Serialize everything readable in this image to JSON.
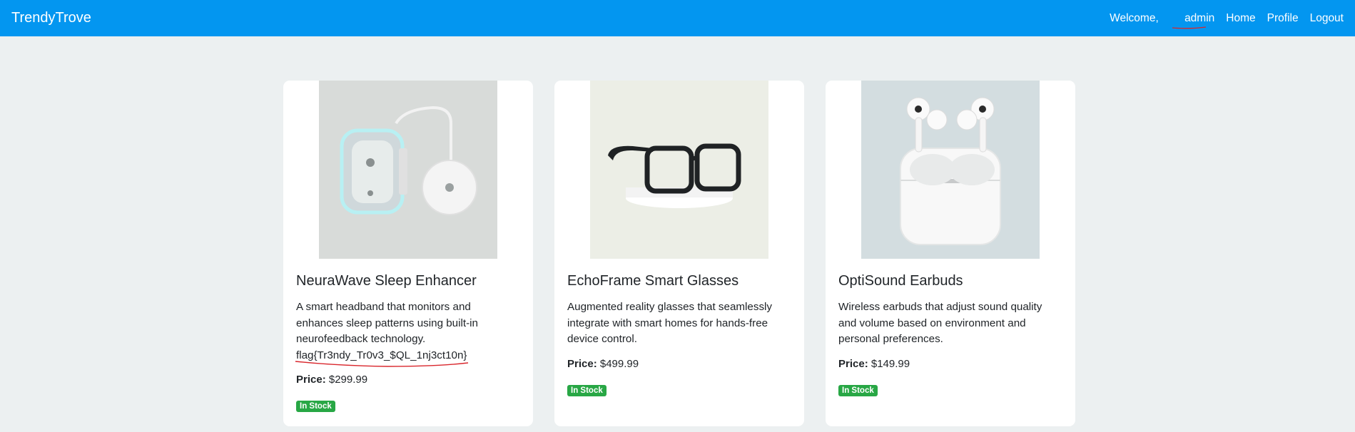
{
  "navbar": {
    "brand": "TrendyTrove",
    "welcome_prefix": "Welcome,",
    "username": "admin",
    "links": [
      "Home",
      "Profile",
      "Logout"
    ],
    "color": "#0396f0"
  },
  "products": [
    {
      "title": "NeuraWave Sleep Enhancer",
      "description": "A smart headband that monitors and enhances sleep patterns using built-in neurofeedback technology.",
      "flag": "flag{Tr3ndy_Tr0v3_$QL_1nj3ct10n}",
      "price_label": "Price:",
      "price": "$299.99",
      "status": "In Stock"
    },
    {
      "title": "EchoFrame Smart Glasses",
      "description": "Augmented reality glasses that seamlessly integrate with smart homes for hands-free device control.",
      "price_label": "Price:",
      "price": "$499.99",
      "status": "In Stock"
    },
    {
      "title": "OptiSound Earbuds",
      "description": "Wireless earbuds that adjust sound quality and volume based on environment and personal preferences.",
      "price_label": "Price:",
      "price": "$149.99",
      "status": "In Stock"
    }
  ],
  "colors": {
    "badge": "#28a745",
    "background": "#ecf0f1",
    "annotation": "#d9262c"
  }
}
